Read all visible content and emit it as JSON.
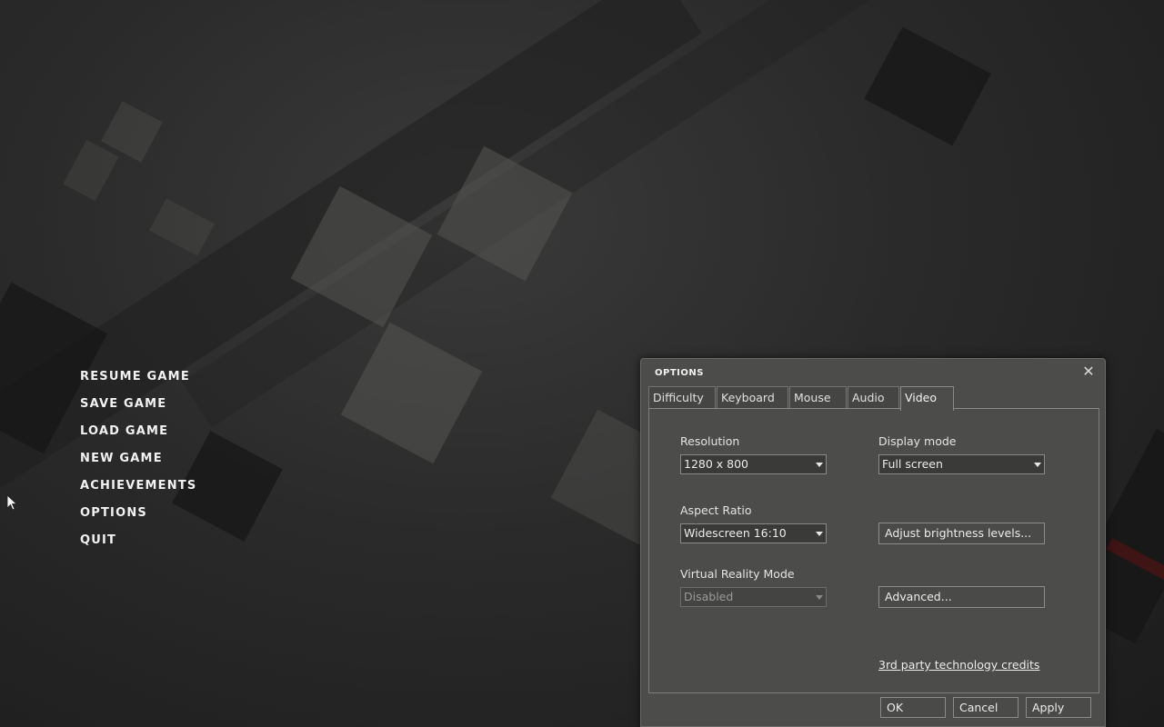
{
  "main_menu": {
    "items": [
      {
        "label": "RESUME GAME"
      },
      {
        "label": "SAVE GAME"
      },
      {
        "label": "LOAD GAME"
      },
      {
        "label": "NEW GAME"
      },
      {
        "label": "ACHIEVEMENTS"
      },
      {
        "label": "OPTIONS"
      },
      {
        "label": "QUIT"
      }
    ]
  },
  "dialog": {
    "title": "OPTIONS",
    "close_icon": "close-icon",
    "tabs": [
      {
        "label": "Difficulty"
      },
      {
        "label": "Keyboard"
      },
      {
        "label": "Mouse"
      },
      {
        "label": "Audio"
      },
      {
        "label": "Video"
      }
    ],
    "active_tab": "Video",
    "video": {
      "resolution": {
        "label": "Resolution",
        "value": "1280 x 800"
      },
      "display_mode": {
        "label": "Display mode",
        "value": "Full screen"
      },
      "aspect_ratio": {
        "label": "Aspect Ratio",
        "value": "Widescreen 16:10"
      },
      "brightness_button": "Adjust brightness levels...",
      "vr_mode": {
        "label": "Virtual Reality Mode",
        "value": "Disabled",
        "disabled": true
      },
      "advanced_button": "Advanced...",
      "credits_link": "3rd party technology credits"
    },
    "footer": {
      "ok": "OK",
      "cancel": "Cancel",
      "apply": "Apply"
    }
  },
  "colors": {
    "dialog_bg": "#4c4c4a",
    "menu_text": "#f2f2f2"
  }
}
